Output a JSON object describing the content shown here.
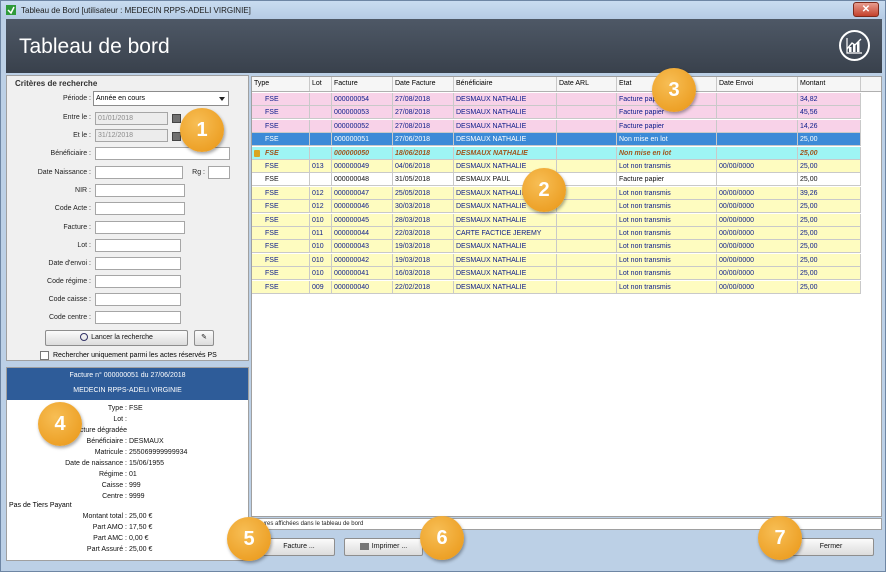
{
  "window": {
    "title": "Tableau de Bord [utilisateur : MEDECIN RPPS-ADELI VIRGINIE]",
    "close": "✕"
  },
  "header": {
    "title": "Tableau de bord"
  },
  "search": {
    "title": "Critères de recherche",
    "periode_label": "Période :",
    "periode_value": "Année en cours",
    "entre_label": "Entre le :",
    "entre_value": "01/01/2018",
    "et_label": "Et le :",
    "et_value": "31/12/2018",
    "beneficiaire_label": "Bénéficiaire :",
    "naissance_label": "Date Naissance :",
    "rg_label": "Rg :",
    "nir_label": "NIR :",
    "code_acte_label": "Code Acte :",
    "facture_label": "Facture :",
    "lot_label": "Lot :",
    "date_envoi_label": "Date d'envoi :",
    "code_regime_label": "Code régime :",
    "code_caisse_label": "Code caisse :",
    "code_centre_label": "Code centre :",
    "search_button": "Lancer la recherche",
    "ps_checkbox_label": "Rechercher uniquement parmi les actes réservés PS"
  },
  "invoice": {
    "header_line1": "Facture n° 000000051  du  27/06/2018",
    "header_line2": "MEDECIN RPPS-ADELI VIRGINIE",
    "rows": [
      {
        "label": "Type :",
        "value": "FSE"
      },
      {
        "label": "Lot :",
        "value": ""
      },
      {
        "label": "Facture dégradée",
        "value": ""
      },
      {
        "label": "Bénéficiaire :",
        "value": "DESMAUX"
      },
      {
        "label": "Matricule :",
        "value": "255069999999934"
      },
      {
        "label": "Date de naissance :",
        "value": "15/06/1955"
      },
      {
        "label": "Régime :",
        "value": "01"
      },
      {
        "label": "Caisse :",
        "value": "999"
      },
      {
        "label": "Centre :",
        "value": "9999"
      }
    ],
    "tiers_payant": "Pas de Tiers Payant",
    "totals": [
      {
        "label": "Montant total :",
        "value": "25,00 €"
      },
      {
        "label": "Part AMO :",
        "value": "17,50 €"
      },
      {
        "label": "Part AMC :",
        "value": "0,00 €"
      },
      {
        "label": "Part Assuré :",
        "value": "25,00 €"
      }
    ]
  },
  "grid": {
    "columns": [
      "Type",
      "Lot",
      "Facture",
      "Date Facture",
      "Bénéficiaire",
      "Date ARL",
      "Etat",
      "Date Envoi",
      "Montant"
    ],
    "rows": [
      {
        "style": "pink",
        "cells": [
          "FSE",
          "",
          "000000054",
          "27/08/2018",
          "DESMAUX NATHALIE",
          "",
          "Facture papier",
          "",
          "34,82"
        ]
      },
      {
        "style": "pink",
        "cells": [
          "FSE",
          "",
          "000000053",
          "27/08/2018",
          "DESMAUX NATHALIE",
          "",
          "Facture papier",
          "",
          "45,56"
        ]
      },
      {
        "style": "pink",
        "cells": [
          "FSE",
          "",
          "000000052",
          "27/08/2018",
          "DESMAUX NATHALIE",
          "",
          "Facture papier",
          "",
          "14,26"
        ]
      },
      {
        "style": "sel",
        "cells": [
          "FSE",
          "",
          "000000051",
          "27/06/2018",
          "DESMAUX NATHALIE",
          "",
          "Non mise en lot",
          "",
          "25,00"
        ]
      },
      {
        "style": "cyan",
        "cells": [
          "FSE",
          "",
          "000000050",
          "18/06/2018",
          "DESMAUX NATHALIE",
          "",
          "Non mise en lot",
          "",
          "25,00"
        ]
      },
      {
        "style": "yellow",
        "cells": [
          "FSE",
          "013",
          "000000049",
          "04/06/2018",
          "DESMAUX NATHALIE",
          "",
          "Lot non transmis",
          "00/00/0000",
          "25,00"
        ]
      },
      {
        "style": "pinkblack",
        "cells": [
          "FSE",
          "",
          "000000048",
          "31/05/2018",
          "DESMAUX PAUL",
          "",
          "Facture papier",
          "",
          "25,00"
        ]
      },
      {
        "style": "yellow",
        "cells": [
          "FSE",
          "012",
          "000000047",
          "25/05/2018",
          "DESMAUX NATHALIE",
          "",
          "Lot non transmis",
          "00/00/0000",
          "39,26"
        ]
      },
      {
        "style": "yellow",
        "cells": [
          "FSE",
          "012",
          "000000046",
          "30/03/2018",
          "DESMAUX NATHALIE",
          "",
          "Lot non transmis",
          "00/00/0000",
          "25,00"
        ]
      },
      {
        "style": "yellow",
        "cells": [
          "FSE",
          "010",
          "000000045",
          "28/03/2018",
          "DESMAUX NATHALIE",
          "",
          "Lot non transmis",
          "00/00/0000",
          "25,00"
        ]
      },
      {
        "style": "yellow",
        "cells": [
          "FSE",
          "011",
          "000000044",
          "22/03/2018",
          "CARTE FACTICE JEREMY",
          "",
          "Lot non transmis",
          "00/00/0000",
          "25,00"
        ]
      },
      {
        "style": "yellow",
        "cells": [
          "FSE",
          "010",
          "000000043",
          "19/03/2018",
          "DESMAUX NATHALIE",
          "",
          "Lot non transmis",
          "00/00/0000",
          "25,00"
        ]
      },
      {
        "style": "yellow",
        "cells": [
          "FSE",
          "010",
          "000000042",
          "19/03/2018",
          "DESMAUX NATHALIE",
          "",
          "Lot non transmis",
          "00/00/0000",
          "25,00"
        ]
      },
      {
        "style": "yellow",
        "cells": [
          "FSE",
          "010",
          "000000041",
          "16/03/2018",
          "DESMAUX NATHALIE",
          "",
          "Lot non transmis",
          "00/00/0000",
          "25,00"
        ]
      },
      {
        "style": "yellow",
        "cells": [
          "FSE",
          "009",
          "000000040",
          "22/02/2018",
          "DESMAUX NATHALIE",
          "",
          "Lot non transmis",
          "00/00/0000",
          "25,00"
        ]
      }
    ]
  },
  "status_text": "...tures affichées dans le tableau de bord",
  "buttons": {
    "facture": "Facture ...",
    "imprimer": "Imprimer ...",
    "fermer": "Fermer"
  },
  "badges": [
    "1",
    "2",
    "3",
    "4",
    "5",
    "6",
    "7"
  ],
  "colors": {
    "header_bg": "#434b57",
    "selected_row": "#3c8ad7",
    "pink_row": "#f8d2e8",
    "yellow_row": "#fefcc0",
    "cyan_row": "#9ef5f4",
    "badge": "#ee9d20"
  }
}
